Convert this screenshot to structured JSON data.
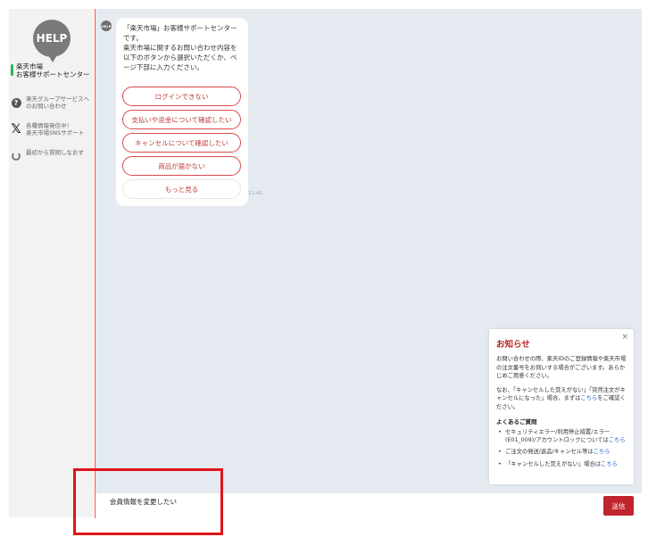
{
  "sidebar": {
    "avatar_text": "HELP",
    "site_name_line1": "楽天市場",
    "site_name_line2": "お客様サポートセンター",
    "items": [
      {
        "icon": "question-icon",
        "line1": "楽天グループサービスへ",
        "line2": "のお問い合わせ"
      },
      {
        "icon": "x-logo-icon",
        "glyph": "𝕏",
        "line1": "各種情報発信中！",
        "line2": "楽天市場SNSサポート"
      },
      {
        "icon": "restart-icon",
        "line1": "最初から質問しなおす",
        "line2": ""
      }
    ]
  },
  "chat": {
    "bot_avatar_text": "HELP",
    "message": "「楽天市場」お客様サポートセンター\nです。\n楽天市場に関するお問い合わせ内容を\n以下のボタンから選択いただくか、ペ\nージ下部に入力ください。",
    "options": [
      "ログインできない",
      "支払いや返金について確認したい",
      "キャンセルについて確認したい",
      "商品が届かない",
      "もっと見る"
    ],
    "time": "11:41"
  },
  "notice": {
    "close": "×",
    "title": "お知らせ",
    "p1": "お問い合わせの際、楽天IDのご登録情報や楽天市場の注文番号をお伺いする場合がございます。あらかじめご用意ください。",
    "p2_before": "なお、「キャンセルした覚えがない」「突然注文がキャンセルになった」場合、まずは",
    "p2_link": "こちら",
    "p2_after": "をご確認ください。",
    "faq_title": "よくあるご質問",
    "faq": [
      {
        "text": "セキュリティエラー/利用停止措置/エラー(E01_009)/アカウントロックについては",
        "link": "こちら"
      },
      {
        "text": "ご注文の発送/返品/キャンセル等は",
        "link": "こちら"
      },
      {
        "text": "「キャンセルした覚えがない」場合は",
        "link": "こちら"
      }
    ]
  },
  "input": {
    "value": "会員情報を変更したい",
    "send_label": "送信"
  },
  "colors": {
    "accent_red": "#c0252d",
    "option_border": "#d94a4a",
    "chat_bg": "#e5e9f0",
    "sidebar_bg": "#f2f2f2",
    "status_green": "#2fb45a",
    "link_blue": "#2266cc",
    "highlight_red": "#e0141b"
  }
}
